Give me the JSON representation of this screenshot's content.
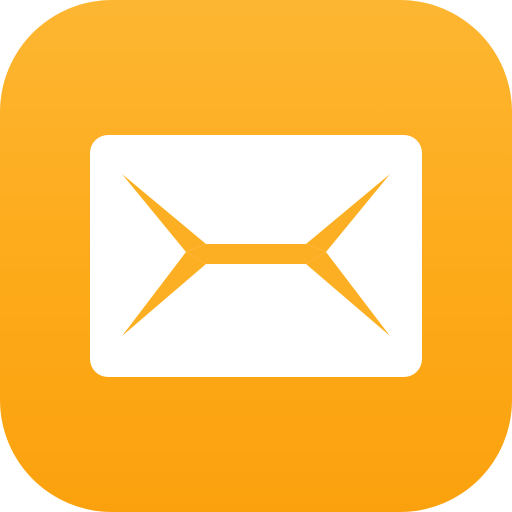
{
  "app_icon": {
    "icon": "mail-icon",
    "colors": {
      "background_top": "#FDB632",
      "background_bottom": "#FBA10E",
      "envelope": "#FFFFFF",
      "fold_lines": "#FCAF22"
    }
  }
}
